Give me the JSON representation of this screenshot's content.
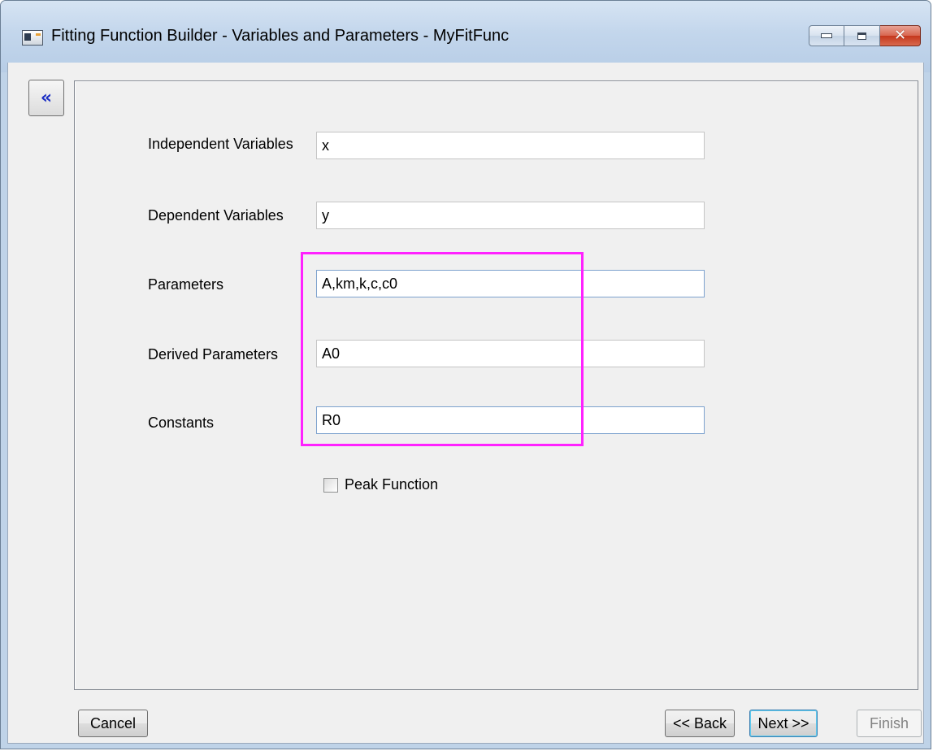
{
  "window": {
    "title": "Fitting Function Builder - Variables and Parameters - MyFitFunc"
  },
  "collapse_button": {
    "label": "«"
  },
  "fields": {
    "independent": {
      "label": "Independent Variables",
      "value": "x"
    },
    "dependent": {
      "label": "Dependent Variables",
      "value": "y"
    },
    "parameters": {
      "label": "Parameters",
      "value": "A,km,k,c,c0"
    },
    "derived": {
      "label": "Derived Parameters",
      "value": "A0"
    },
    "constants": {
      "label": "Constants",
      "value": "R0"
    }
  },
  "peak_function": {
    "label": "Peak Function",
    "checked": false
  },
  "footer": {
    "cancel": "Cancel",
    "back": "<< Back",
    "next": "Next >>",
    "finish": "Finish"
  },
  "colors": {
    "highlight": "#ff22ff",
    "collapse_arrow": "#1c2fc4",
    "close_button": "#c5371d"
  }
}
